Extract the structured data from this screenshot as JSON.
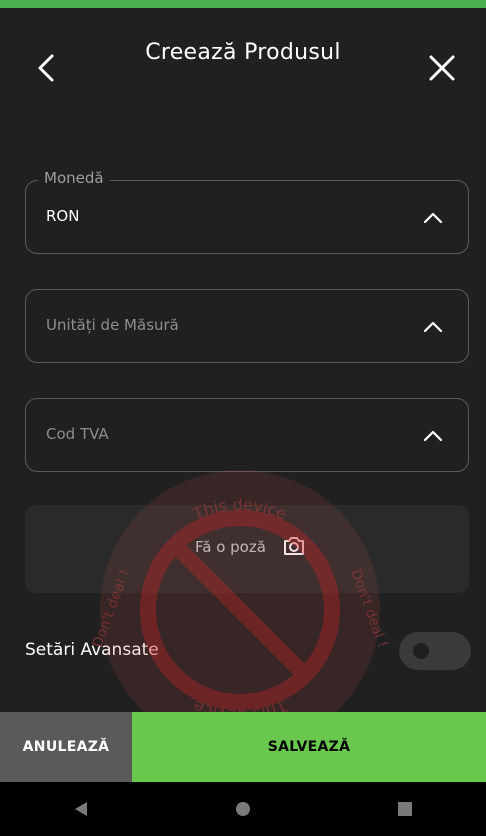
{
  "header": {
    "title": "Creează Produsul",
    "back_icon": "chevron-left-icon",
    "close_icon": "close-icon"
  },
  "fields": {
    "currency": {
      "legend": "Monedă",
      "value": "RON"
    },
    "units": {
      "placeholder": "Unități de Măsură"
    },
    "vat": {
      "placeholder": "Cod TVA"
    }
  },
  "photo": {
    "label": "Fă o poză",
    "icon": "camera-icon"
  },
  "advanced": {
    "label": "Setări Avansate",
    "toggle_on": false
  },
  "actions": {
    "cancel_label": "ANULEAZĂ",
    "save_label": "SALVEAZĂ"
  },
  "watermark": {
    "text_top": "This device",
    "text_bottom": "This device",
    "text_right": "Don't deal !",
    "text_left": "Don't deal !"
  },
  "colors": {
    "accent": "#69c84d",
    "background": "#202020",
    "field_border": "#5a5a5a",
    "cancel_bg": "#5a5a5a",
    "watermark_red": "#cc2a2a"
  }
}
